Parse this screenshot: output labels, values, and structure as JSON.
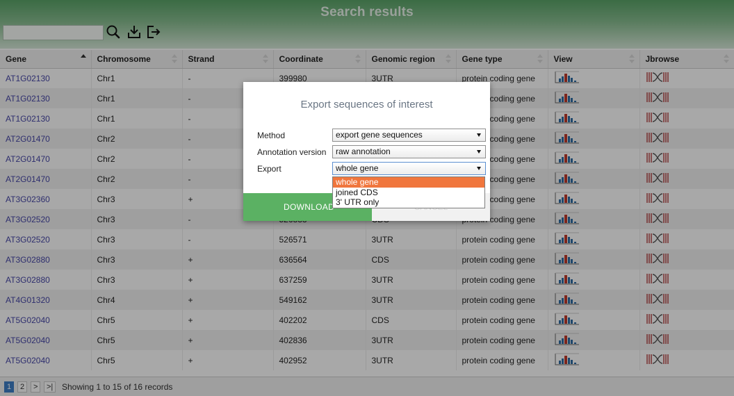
{
  "header": {
    "title": "Search results",
    "search_value": "",
    "icons": [
      "search-icon",
      "download-icon",
      "export-icon"
    ]
  },
  "table": {
    "columns": [
      "Gene",
      "Chromosome",
      "Strand",
      "Coordinate",
      "Genomic region",
      "Gene type",
      "View",
      "Jbrowse"
    ],
    "sorted_column": "Gene",
    "rows": [
      {
        "gene": "AT1G02130",
        "chromosome": "Chr1",
        "strand": "-",
        "coordinate": "399980",
        "region": "3UTR",
        "type": "protein coding gene"
      },
      {
        "gene": "AT1G02130",
        "chromosome": "Chr1",
        "strand": "-",
        "coordinate": "",
        "region": "",
        "type": "protein coding gene"
      },
      {
        "gene": "AT1G02130",
        "chromosome": "Chr1",
        "strand": "-",
        "coordinate": "",
        "region": "",
        "type": "protein coding gene"
      },
      {
        "gene": "AT2G01470",
        "chromosome": "Chr2",
        "strand": "-",
        "coordinate": "",
        "region": "",
        "type": "protein coding gene"
      },
      {
        "gene": "AT2G01470",
        "chromosome": "Chr2",
        "strand": "-",
        "coordinate": "",
        "region": "",
        "type": "protein coding gene"
      },
      {
        "gene": "AT2G01470",
        "chromosome": "Chr2",
        "strand": "-",
        "coordinate": "",
        "region": "",
        "type": "protein coding gene"
      },
      {
        "gene": "AT3G02360",
        "chromosome": "Chr3",
        "strand": "+",
        "coordinate": "",
        "region": "",
        "type": "protein coding gene"
      },
      {
        "gene": "AT3G02520",
        "chromosome": "Chr3",
        "strand": "-",
        "coordinate": "526833",
        "region": "CDS",
        "type": "protein coding gene"
      },
      {
        "gene": "AT3G02520",
        "chromosome": "Chr3",
        "strand": "-",
        "coordinate": "526571",
        "region": "3UTR",
        "type": "protein coding gene"
      },
      {
        "gene": "AT3G02880",
        "chromosome": "Chr3",
        "strand": "+",
        "coordinate": "636564",
        "region": "CDS",
        "type": "protein coding gene"
      },
      {
        "gene": "AT3G02880",
        "chromosome": "Chr3",
        "strand": "+",
        "coordinate": "637259",
        "region": "3UTR",
        "type": "protein coding gene"
      },
      {
        "gene": "AT4G01320",
        "chromosome": "Chr4",
        "strand": "+",
        "coordinate": "549162",
        "region": "3UTR",
        "type": "protein coding gene"
      },
      {
        "gene": "AT5G02040",
        "chromosome": "Chr5",
        "strand": "+",
        "coordinate": "402202",
        "region": "CDS",
        "type": "protein coding gene"
      },
      {
        "gene": "AT5G02040",
        "chromosome": "Chr5",
        "strand": "+",
        "coordinate": "402836",
        "region": "3UTR",
        "type": "protein coding gene"
      },
      {
        "gene": "AT5G02040",
        "chromosome": "Chr5",
        "strand": "+",
        "coordinate": "402952",
        "region": "3UTR",
        "type": "protein coding gene"
      }
    ]
  },
  "pagination": {
    "pages": [
      "1",
      "2",
      ">",
      ">|"
    ],
    "current": "1",
    "info": "Showing 1 to 15 of 16 records"
  },
  "modal": {
    "title": "Export sequences of interest",
    "method_label": "Method",
    "method_value": "export gene sequences",
    "annotation_label": "Annotation version",
    "annotation_value": "raw annotation",
    "export_label": "Export",
    "export_value": "whole gene",
    "export_options": [
      "whole gene",
      "joined CDS",
      "3' UTR only"
    ],
    "download_label": "DOWNLOAD",
    "cancel_label": "CANCEL"
  },
  "colors": {
    "header_green": "#5aa468",
    "download_green": "#5bb163",
    "selected_option": "#f0763d",
    "gene_link": "#4747a8",
    "active_page": "#3f7fc5"
  }
}
